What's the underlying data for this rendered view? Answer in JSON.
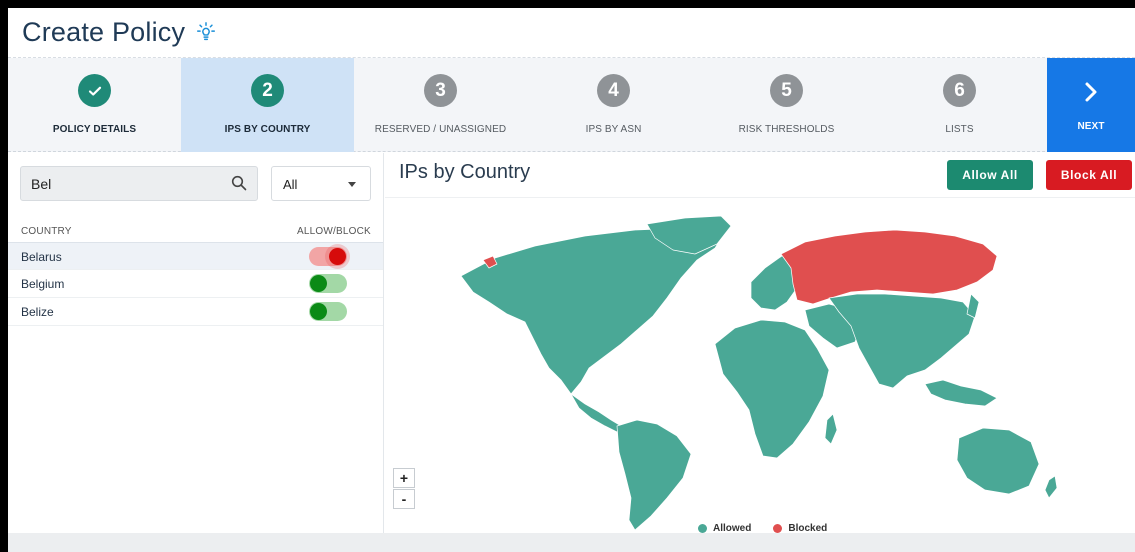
{
  "header": {
    "title": "Create Policy",
    "icon": "lightbulb-icon"
  },
  "steps": [
    {
      "number": "✓",
      "label": "POLICY DETAILS",
      "state": "done"
    },
    {
      "number": "2",
      "label": "IPS BY COUNTRY",
      "state": "active"
    },
    {
      "number": "3",
      "label": "RESERVED / UNASSIGNED",
      "state": "pending"
    },
    {
      "number": "4",
      "label": "IPS BY ASN",
      "state": "pending"
    },
    {
      "number": "5",
      "label": "RISK THRESHOLDS",
      "state": "pending"
    },
    {
      "number": "6",
      "label": "LISTS",
      "state": "pending"
    }
  ],
  "next": {
    "label": "NEXT",
    "icon": "chevron-right-icon"
  },
  "search": {
    "value": "Bel",
    "icon": "search-icon"
  },
  "filter": {
    "selected": "All"
  },
  "table": {
    "col_country": "COUNTRY",
    "col_allow_block": "ALLOW/BLOCK",
    "rows": [
      {
        "name": "Belarus",
        "status": "blocked"
      },
      {
        "name": "Belgium",
        "status": "allowed"
      },
      {
        "name": "Belize",
        "status": "allowed"
      }
    ]
  },
  "panel": {
    "title": "IPs by Country",
    "allow_all": "Allow All",
    "block_all": "Block All"
  },
  "zoom": {
    "plus": "+",
    "minus": "-"
  },
  "legend": {
    "allowed": "Allowed",
    "blocked": "Blocked"
  },
  "colors": {
    "allowed": "#4aa896",
    "blocked": "#e04f4f",
    "accent": "#1f8a78",
    "next": "#1678e6",
    "block_button": "#d81b22"
  }
}
